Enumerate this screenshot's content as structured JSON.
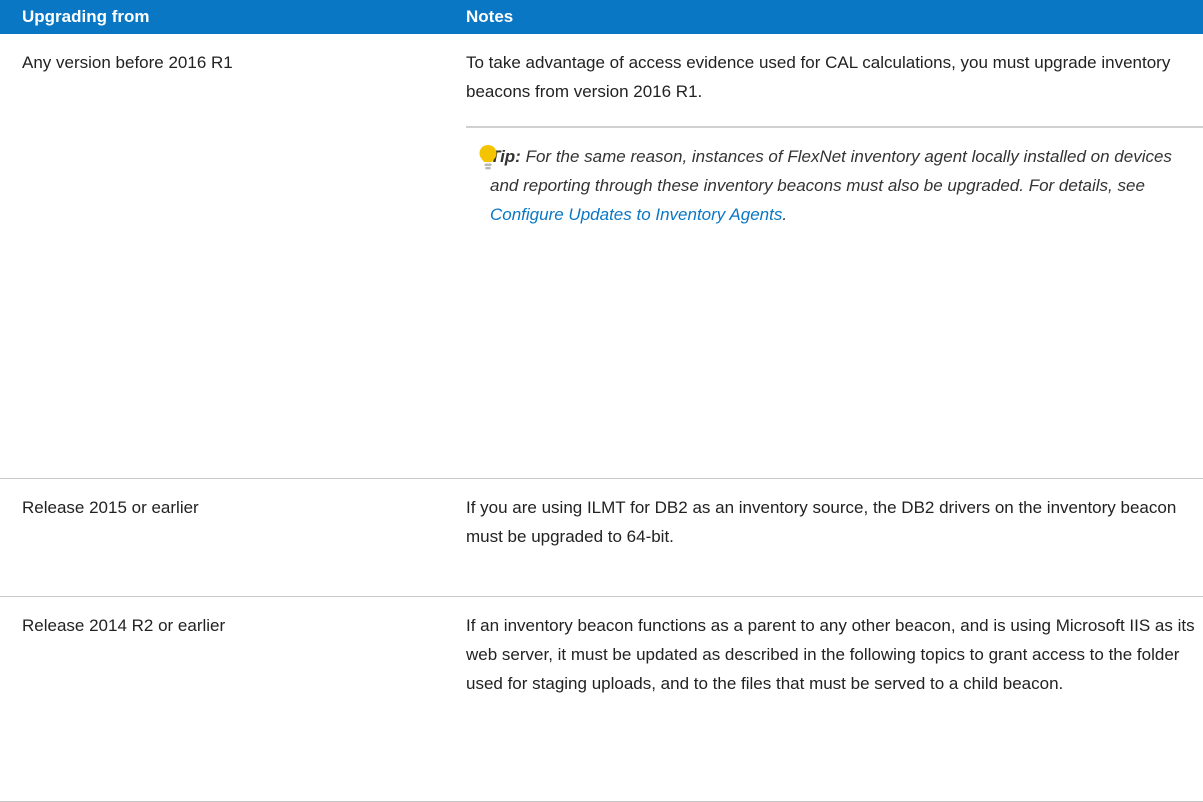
{
  "table": {
    "headers": {
      "upgrading_from": "Upgrading from",
      "notes": "Notes"
    },
    "rows": [
      {
        "from": "Any version before 2016 R1",
        "note": "To take advantage of access evidence used for CAL calculations, you must upgrade inventory beacons from version 2016 R1.",
        "tip": {
          "label": "Tip:",
          "text": "For the same reason, instances of FlexNet inventory agent locally installed on devices and reporting through these inventory beacons must also be upgraded. For details, see",
          "link": "Configure Updates to Inventory Agents",
          "suffix": "."
        }
      },
      {
        "from": "Release 2015 or earlier",
        "note": "If you are using ILMT for DB2 as an inventory source, the DB2 drivers on the inventory beacon must be upgraded to 64-bit."
      },
      {
        "from": "Release 2014 R2 or earlier",
        "note": "If an inventory beacon functions as a parent to any other beacon, and is using Microsoft IIS as its web server, it must be updated as described in the following topics to grant access to the folder used for staging uploads, and to the files that must be served to a child beacon."
      }
    ]
  },
  "colors": {
    "header_bg": "#0a77c4",
    "link": "#0a77c4",
    "tip_bulb": "#f5c400"
  },
  "icons": {
    "tip": "lightbulb-icon"
  }
}
